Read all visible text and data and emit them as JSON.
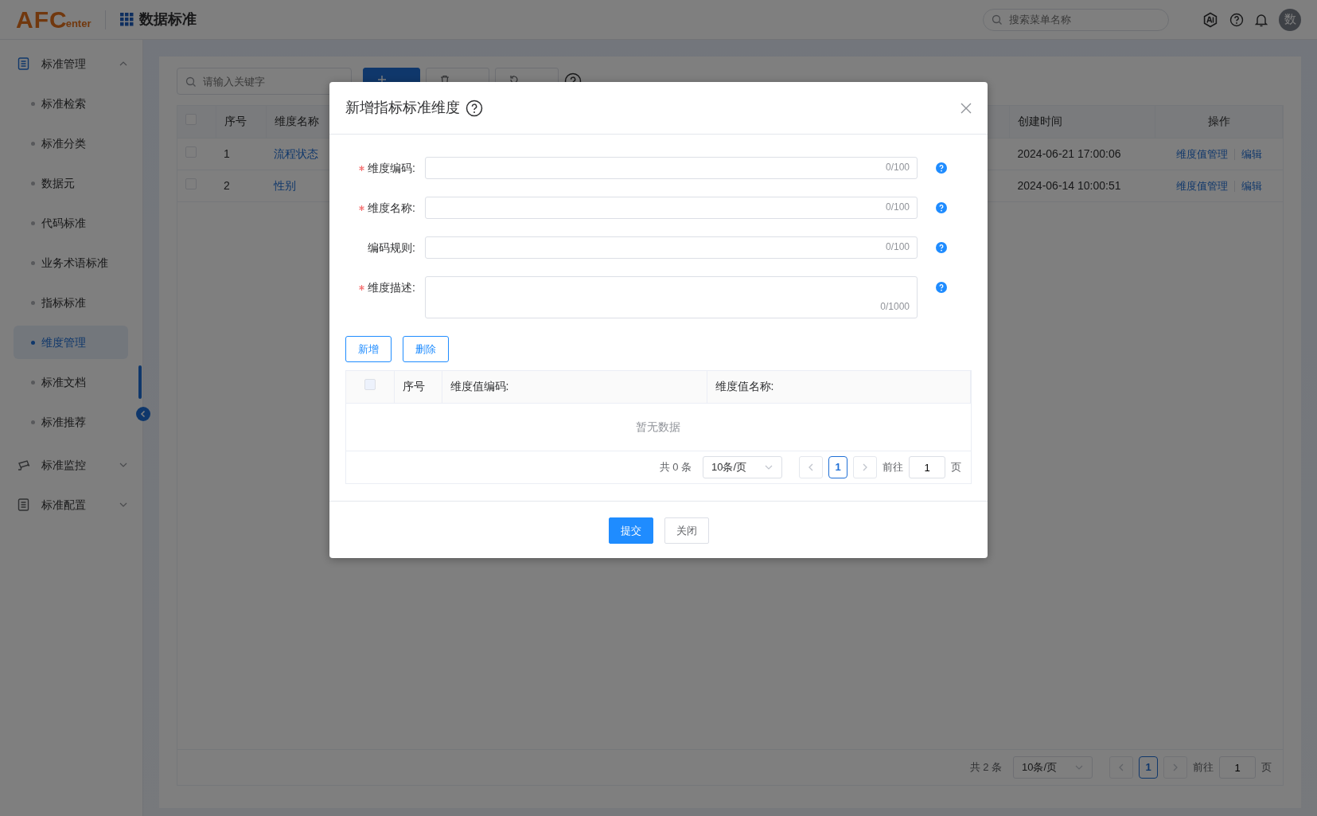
{
  "header": {
    "logo": {
      "main": "AFC",
      "sub": "enter"
    },
    "app_title": "数据标准",
    "search": {
      "placeholder": "搜索菜单名称"
    },
    "avatar": "数"
  },
  "sidebar": {
    "items": [
      {
        "label": "标准管理",
        "kind": "document",
        "expanded": true,
        "selected": false,
        "children": [
          {
            "label": "标准检索",
            "selected": false
          },
          {
            "label": "标准分类",
            "selected": false
          },
          {
            "label": "数据元",
            "selected": false
          },
          {
            "label": "代码标准",
            "selected": false
          },
          {
            "label": "业务术语标准",
            "selected": false
          },
          {
            "label": "指标标准",
            "selected": false
          },
          {
            "label": "维度管理",
            "selected": true
          },
          {
            "label": "标准文档",
            "selected": false
          },
          {
            "label": "标准推荐",
            "selected": false
          }
        ]
      },
      {
        "label": "标准监控",
        "kind": "camera",
        "expanded": false,
        "selected": false
      },
      {
        "label": "标准配置",
        "kind": "document",
        "expanded": false,
        "selected": false
      }
    ]
  },
  "toolbar": {
    "search": {
      "placeholder": "请输入关键字"
    },
    "buttons": [
      {
        "kind": "add"
      },
      {
        "kind": "delete"
      },
      {
        "kind": "reset"
      }
    ]
  },
  "table": {
    "header_checked": false,
    "columns": [
      "序号",
      "维度名称",
      "创建时间",
      "操作"
    ],
    "rows": [
      {
        "checked": false,
        "index": "1",
        "name": "流程状态",
        "created": "2024-06-21 17:00:06",
        "actions": [
          "维度值管理",
          "编辑"
        ]
      },
      {
        "checked": false,
        "index": "2",
        "name": "性别",
        "created": "2024-06-14 10:00:51",
        "actions": [
          "维度值管理",
          "编辑"
        ]
      }
    ],
    "pagination": {
      "total": "共 2 条",
      "page_size": "10条/页",
      "pages": [
        {
          "label": "1",
          "selected": true
        }
      ],
      "goto_label": "前往",
      "goto_value": "1",
      "goto_suffix": "页"
    }
  },
  "dialog": {
    "title": "新增指标标准维度",
    "fields": [
      {
        "label": "维度编码:",
        "required": true,
        "kind": "input",
        "counter": "0/100"
      },
      {
        "label": "维度名称:",
        "required": true,
        "kind": "input",
        "counter": "0/100"
      },
      {
        "label": "编码规则:",
        "required": false,
        "kind": "input",
        "counter": "0/100"
      },
      {
        "label": "维度描述:",
        "required": true,
        "kind": "textarea",
        "counter": "0/1000"
      }
    ],
    "buttons": [
      "新增",
      "删除"
    ],
    "table": {
      "columns": [
        "序号",
        "维度值编码:",
        "维度值名称:"
      ],
      "header_checked": false,
      "empty_text": "暂无数据",
      "pagination": {
        "total": "共 0 条",
        "page_size": "10条/页",
        "pages": [
          {
            "label": "1",
            "selected": true
          }
        ],
        "goto_label": "前往",
        "goto_value": "1",
        "goto_suffix": "页"
      }
    },
    "footer_buttons": [
      {
        "label": "提交",
        "kind": "primary"
      },
      {
        "label": "关闭",
        "kind": "plain"
      }
    ]
  }
}
